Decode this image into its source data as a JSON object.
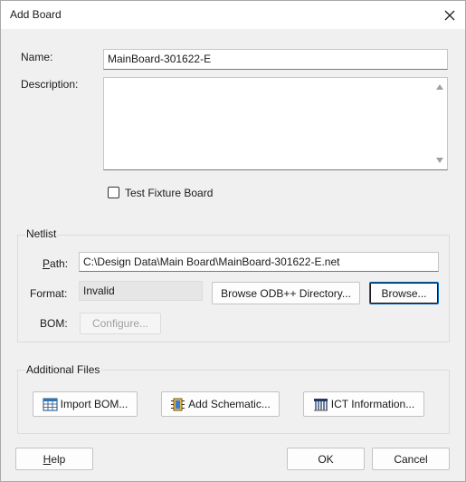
{
  "window": {
    "title": "Add Board",
    "close_icon": "close-icon"
  },
  "board": {
    "name_label": "Name:",
    "name_value": "MainBoard-301622-E",
    "description_label": "Description:",
    "description_value": "",
    "test_fixture_label": "Test Fixture Board",
    "test_fixture_checked": false
  },
  "netlist": {
    "group_title": "Netlist",
    "path_label_underlined": "P",
    "path_label_rest": "ath:",
    "path_value": "C:\\Design Data\\Main Board\\MainBoard-301622-E.net",
    "format_label": "Format:",
    "format_value": "Invalid",
    "browse_odb_label": "Browse ODB++ Directory...",
    "browse_label": "Browse...",
    "bom_label": "BOM:",
    "configure_label": "Configure..."
  },
  "additional_files": {
    "group_title": "Additional Files",
    "import_bom_label": "Import BOM...",
    "add_schematic_label": "Add Schematic...",
    "ict_information_label": "ICT Information..."
  },
  "footer": {
    "help_underlined": "H",
    "help_rest": "elp",
    "ok_label": "OK",
    "cancel_label": "Cancel"
  },
  "icons": {
    "import_bom": "table-icon",
    "add_schematic": "chip-icon",
    "ict_information": "ict-fixture-icon"
  }
}
